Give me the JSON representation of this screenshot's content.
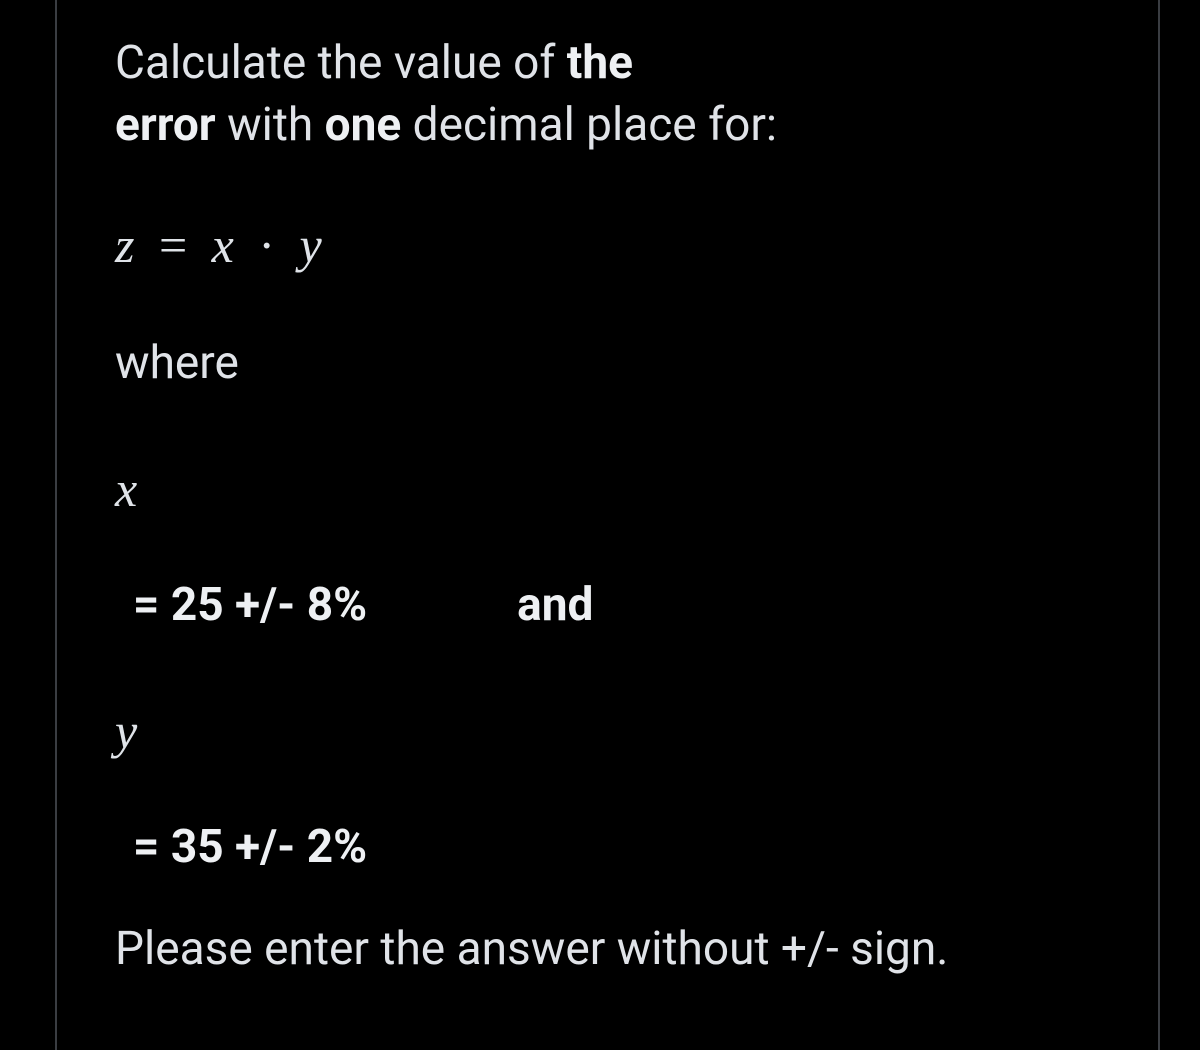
{
  "prompt": {
    "line1_pre": "Calculate the value of ",
    "line1_bold": "the",
    "line2_bold1": "error",
    "line2_mid": " with ",
    "line2_bold2": "one",
    "line2_post": " decimal place for:"
  },
  "equation": {
    "z": "z",
    "eq": "=",
    "x": "x",
    "dot": "·",
    "y": "y"
  },
  "where": "where",
  "varX": "x",
  "valX": "= 25 +/- 8%",
  "and": "and",
  "varY": "y",
  "valY": "= 35 +/- 2%",
  "note": "Please enter the answer without +/- sign."
}
